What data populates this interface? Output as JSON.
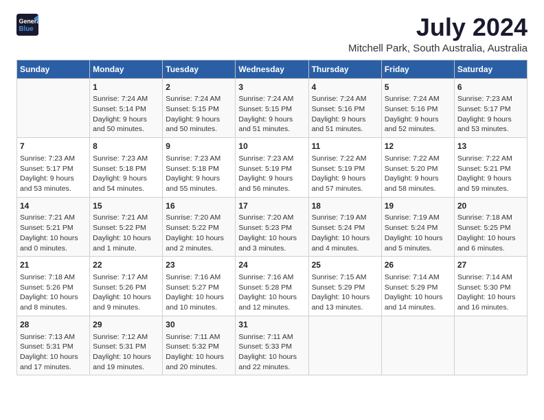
{
  "logo": {
    "line1": "General",
    "line2": "Blue"
  },
  "title": "July 2024",
  "subtitle": "Mitchell Park, South Australia, Australia",
  "header_days": [
    "Sunday",
    "Monday",
    "Tuesday",
    "Wednesday",
    "Thursday",
    "Friday",
    "Saturday"
  ],
  "weeks": [
    [
      {
        "day": "",
        "text": ""
      },
      {
        "day": "1",
        "text": "Sunrise: 7:24 AM\nSunset: 5:14 PM\nDaylight: 9 hours\nand 50 minutes."
      },
      {
        "day": "2",
        "text": "Sunrise: 7:24 AM\nSunset: 5:15 PM\nDaylight: 9 hours\nand 50 minutes."
      },
      {
        "day": "3",
        "text": "Sunrise: 7:24 AM\nSunset: 5:15 PM\nDaylight: 9 hours\nand 51 minutes."
      },
      {
        "day": "4",
        "text": "Sunrise: 7:24 AM\nSunset: 5:16 PM\nDaylight: 9 hours\nand 51 minutes."
      },
      {
        "day": "5",
        "text": "Sunrise: 7:24 AM\nSunset: 5:16 PM\nDaylight: 9 hours\nand 52 minutes."
      },
      {
        "day": "6",
        "text": "Sunrise: 7:23 AM\nSunset: 5:17 PM\nDaylight: 9 hours\nand 53 minutes."
      }
    ],
    [
      {
        "day": "7",
        "text": "Sunrise: 7:23 AM\nSunset: 5:17 PM\nDaylight: 9 hours\nand 53 minutes."
      },
      {
        "day": "8",
        "text": "Sunrise: 7:23 AM\nSunset: 5:18 PM\nDaylight: 9 hours\nand 54 minutes."
      },
      {
        "day": "9",
        "text": "Sunrise: 7:23 AM\nSunset: 5:18 PM\nDaylight: 9 hours\nand 55 minutes."
      },
      {
        "day": "10",
        "text": "Sunrise: 7:23 AM\nSunset: 5:19 PM\nDaylight: 9 hours\nand 56 minutes."
      },
      {
        "day": "11",
        "text": "Sunrise: 7:22 AM\nSunset: 5:19 PM\nDaylight: 9 hours\nand 57 minutes."
      },
      {
        "day": "12",
        "text": "Sunrise: 7:22 AM\nSunset: 5:20 PM\nDaylight: 9 hours\nand 58 minutes."
      },
      {
        "day": "13",
        "text": "Sunrise: 7:22 AM\nSunset: 5:21 PM\nDaylight: 9 hours\nand 59 minutes."
      }
    ],
    [
      {
        "day": "14",
        "text": "Sunrise: 7:21 AM\nSunset: 5:21 PM\nDaylight: 10 hours\nand 0 minutes."
      },
      {
        "day": "15",
        "text": "Sunrise: 7:21 AM\nSunset: 5:22 PM\nDaylight: 10 hours\nand 1 minute."
      },
      {
        "day": "16",
        "text": "Sunrise: 7:20 AM\nSunset: 5:22 PM\nDaylight: 10 hours\nand 2 minutes."
      },
      {
        "day": "17",
        "text": "Sunrise: 7:20 AM\nSunset: 5:23 PM\nDaylight: 10 hours\nand 3 minutes."
      },
      {
        "day": "18",
        "text": "Sunrise: 7:19 AM\nSunset: 5:24 PM\nDaylight: 10 hours\nand 4 minutes."
      },
      {
        "day": "19",
        "text": "Sunrise: 7:19 AM\nSunset: 5:24 PM\nDaylight: 10 hours\nand 5 minutes."
      },
      {
        "day": "20",
        "text": "Sunrise: 7:18 AM\nSunset: 5:25 PM\nDaylight: 10 hours\nand 6 minutes."
      }
    ],
    [
      {
        "day": "21",
        "text": "Sunrise: 7:18 AM\nSunset: 5:26 PM\nDaylight: 10 hours\nand 8 minutes."
      },
      {
        "day": "22",
        "text": "Sunrise: 7:17 AM\nSunset: 5:26 PM\nDaylight: 10 hours\nand 9 minutes."
      },
      {
        "day": "23",
        "text": "Sunrise: 7:16 AM\nSunset: 5:27 PM\nDaylight: 10 hours\nand 10 minutes."
      },
      {
        "day": "24",
        "text": "Sunrise: 7:16 AM\nSunset: 5:28 PM\nDaylight: 10 hours\nand 12 minutes."
      },
      {
        "day": "25",
        "text": "Sunrise: 7:15 AM\nSunset: 5:29 PM\nDaylight: 10 hours\nand 13 minutes."
      },
      {
        "day": "26",
        "text": "Sunrise: 7:14 AM\nSunset: 5:29 PM\nDaylight: 10 hours\nand 14 minutes."
      },
      {
        "day": "27",
        "text": "Sunrise: 7:14 AM\nSunset: 5:30 PM\nDaylight: 10 hours\nand 16 minutes."
      }
    ],
    [
      {
        "day": "28",
        "text": "Sunrise: 7:13 AM\nSunset: 5:31 PM\nDaylight: 10 hours\nand 17 minutes."
      },
      {
        "day": "29",
        "text": "Sunrise: 7:12 AM\nSunset: 5:31 PM\nDaylight: 10 hours\nand 19 minutes."
      },
      {
        "day": "30",
        "text": "Sunrise: 7:11 AM\nSunset: 5:32 PM\nDaylight: 10 hours\nand 20 minutes."
      },
      {
        "day": "31",
        "text": "Sunrise: 7:11 AM\nSunset: 5:33 PM\nDaylight: 10 hours\nand 22 minutes."
      },
      {
        "day": "",
        "text": ""
      },
      {
        "day": "",
        "text": ""
      },
      {
        "day": "",
        "text": ""
      }
    ]
  ]
}
